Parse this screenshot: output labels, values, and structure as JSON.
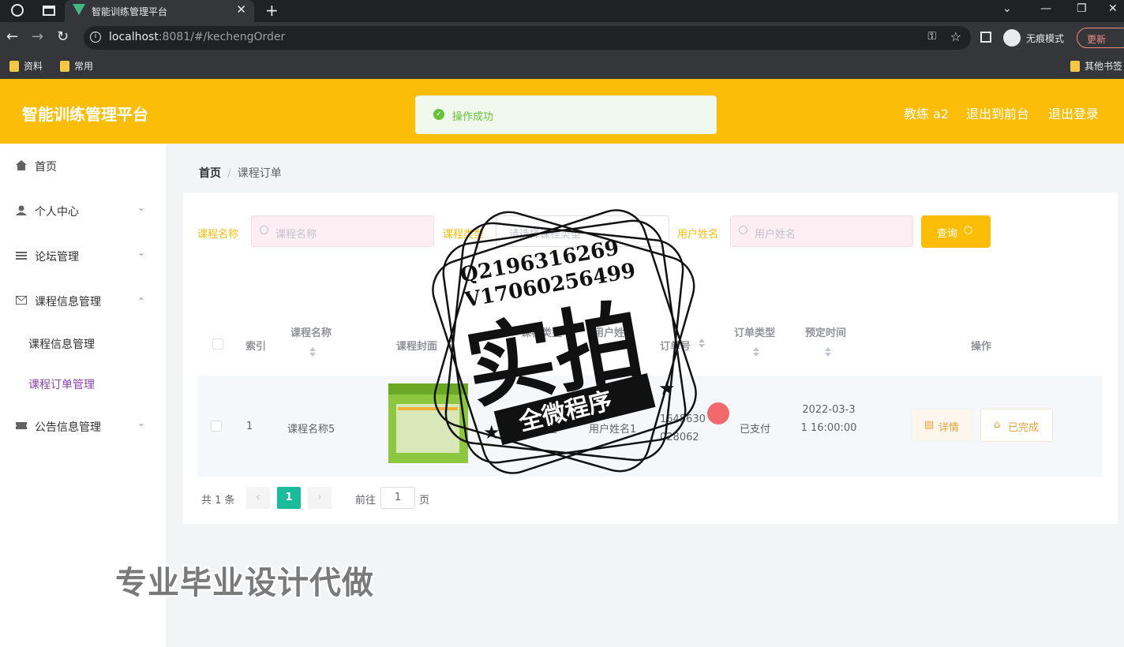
{
  "browser": {
    "tab_title": "智能训练管理平台",
    "url_host": "localhost",
    "url_rest": ":8081/#/kechengOrder",
    "incognito_label": "无痕模式",
    "update_label": "更新",
    "bookmarks": [
      "资料",
      "常用"
    ],
    "other_bookmarks": "其他书签"
  },
  "header": {
    "brand": "智能训练管理平台",
    "user": "教练 a2",
    "to_front": "退出到前台",
    "logout": "退出登录",
    "accent_color": "#fbbd08"
  },
  "toast": {
    "message": "操作成功"
  },
  "sidebar": {
    "items": [
      {
        "label": "首页",
        "icon": "home-icon"
      },
      {
        "label": "个人中心",
        "icon": "user-icon"
      },
      {
        "label": "论坛管理",
        "icon": "list-icon"
      },
      {
        "label": "课程信息管理",
        "icon": "mail-icon"
      },
      {
        "label": "公告信息管理",
        "icon": "ticket-icon"
      }
    ],
    "sub_items": [
      "课程信息管理",
      "课程订单管理"
    ]
  },
  "breadcrumb": {
    "home": "首页",
    "current": "课程订单"
  },
  "search": {
    "course_name_label": "课程名称",
    "course_name_placeholder": "课程名称",
    "course_type_label": "课程类型",
    "course_type_placeholder": "请选择课程类型",
    "user_name_label": "用户姓名",
    "user_name_placeholder": "用户姓名",
    "query_button": "查询"
  },
  "table": {
    "headers": {
      "index": "索引",
      "course_name": "课程名称",
      "cover": "课程封面",
      "course_type": "课程类型",
      "user": "用户姓名",
      "order_no": "订单号",
      "order_type": "订单类型",
      "book_time": "预定时间",
      "actions": "操作"
    },
    "rows": [
      {
        "index": "1",
        "course_name": "课程名称5",
        "course_type": "课程类型",
        "user": "用户姓名1",
        "order_no": "1648630028062",
        "order_type": "已支付",
        "book_time": "2022-03-31 16:00:00",
        "detail_button": "详情",
        "done_button": "已完成"
      }
    ]
  },
  "pagination": {
    "total": "共 1 条",
    "current": "1",
    "goto": "前往",
    "page_value": "1",
    "unit": "页"
  },
  "watermark": {
    "line1": "Q2196316269",
    "line2": "V17060256499",
    "big": "实拍",
    "banner": "全微程序",
    "caption": "专业毕业设计代做"
  }
}
